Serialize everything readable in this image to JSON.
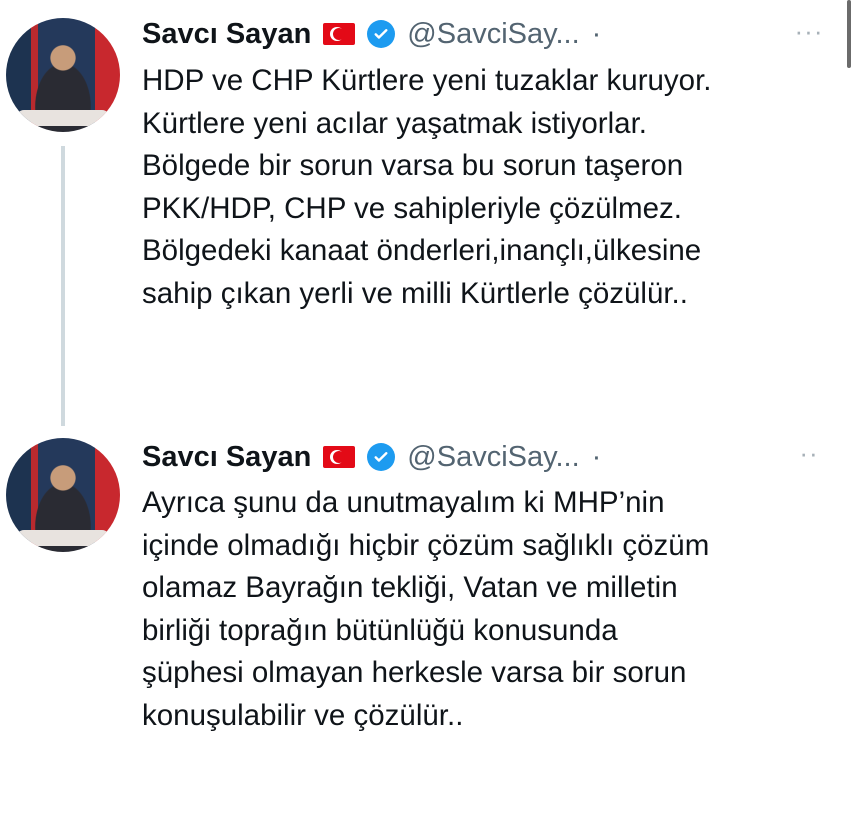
{
  "tweets": [
    {
      "author_name": "Savcı Sayan",
      "handle": "@SavciSay...",
      "separator": "·",
      "more_label": "···",
      "flag_icon": "turkey-flag-icon",
      "verified_icon": "verified-badge-icon",
      "text": "HDP ve CHP Kürtlere yeni tuzaklar kuruyor.\nKürtlere yeni acılar yaşatmak istiyorlar.\nBölgede bir sorun varsa bu sorun taşeron\nPKK/HDP, CHP ve sahipleriyle çözülmez.\nBölgedeki kanaat önderleri,inançlı,ülkesine\nsahip çıkan yerli ve milli Kürtlerle çözülür.."
    },
    {
      "author_name": "Savcı Sayan",
      "handle": "@SavciSay...",
      "separator": "·",
      "more_label": "··",
      "flag_icon": "turkey-flag-icon",
      "verified_icon": "verified-badge-icon",
      "text": "Ayrıca şunu da unutmayalım ki MHP’nin\niçinde olmadığı hiçbir çözüm sağlıklı çözüm\nolamaz Bayrağın tekliği, Vatan ve milletin\nbirliği toprağın bütünlüğü  konusunda\nşüphesi olmayan herkesle varsa bir sorun\nkonuşulabilir ve çözülür.."
    }
  ],
  "colors": {
    "text": "#0f1419",
    "secondary": "#536471",
    "verified": "#1d9bf0",
    "thread_line": "#cfd9de",
    "flag_red": "#e30a17"
  }
}
